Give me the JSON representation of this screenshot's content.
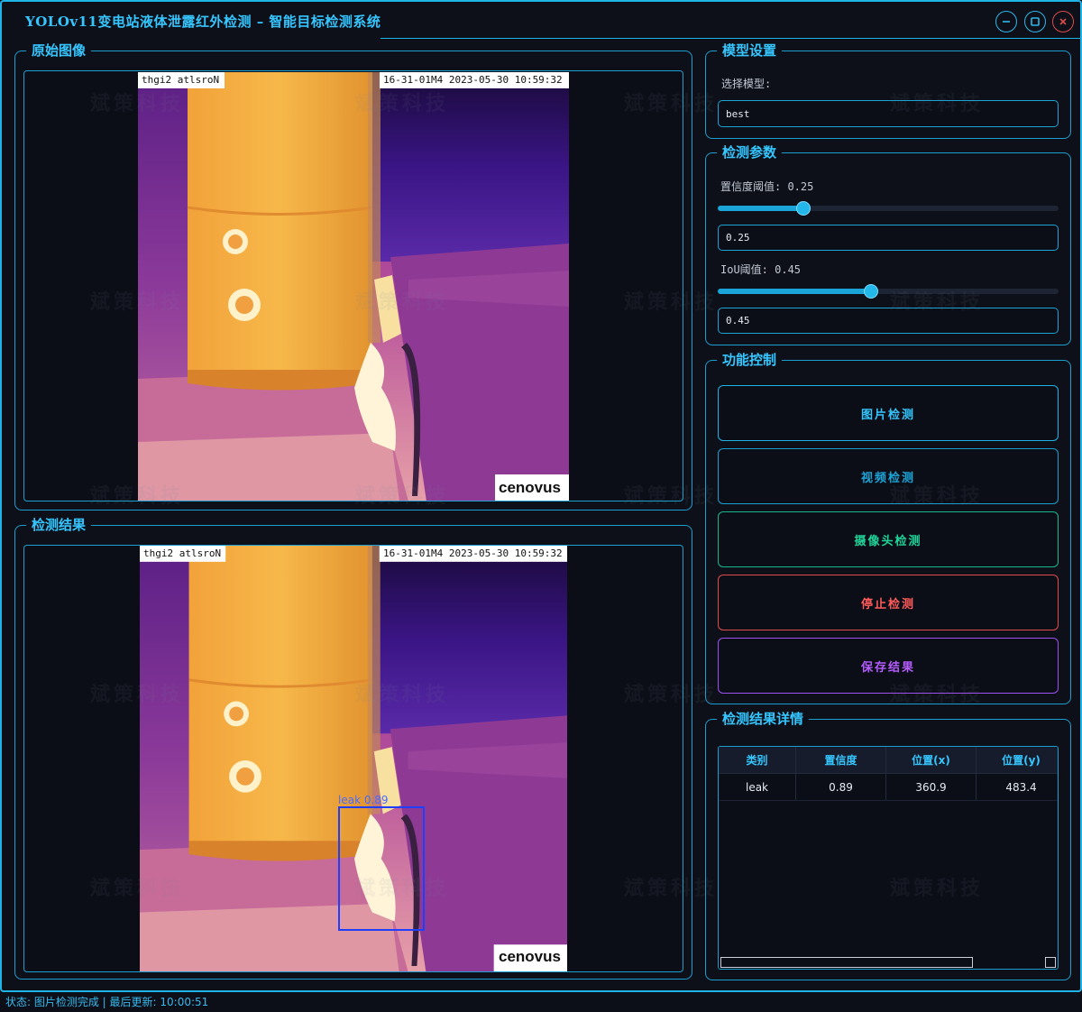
{
  "window": {
    "title": "YOLOv11变电站液体泄露红外检测 – 智能目标检测系统"
  },
  "panels": {
    "original_title": "原始图像",
    "result_title": "检测结果",
    "image_overlay_left": "thgi2 atlsroN",
    "image_overlay_right": "16-31-01M4 2023-05-30 10:59:32",
    "image_logo": "cenovus",
    "detection_box_label": "leak 0.89"
  },
  "model": {
    "title": "模型设置",
    "select_label": "选择模型:",
    "selected": "best"
  },
  "params": {
    "title": "检测参数",
    "conf_label": "置信度阈值: 0.25",
    "conf_value": "0.25",
    "conf_level": 0.25,
    "iou_label": "IoU阈值: 0.45",
    "iou_value": "0.45",
    "iou_level": 0.45
  },
  "controls": {
    "title": "功能控制",
    "image_btn": "图片检测",
    "video_btn": "视频检测",
    "camera_btn": "摄像头检测",
    "stop_btn": "停止检测",
    "save_btn": "保存结果"
  },
  "results": {
    "title": "检测结果详情",
    "headers": [
      "类别",
      "置信度",
      "位置(x)",
      "位置(y)"
    ],
    "rows": [
      [
        "leak",
        "0.89",
        "360.9",
        "483.4"
      ]
    ]
  },
  "status": {
    "text": "状态: 图片检测完成 | 最后更新: 10:00:51"
  },
  "watermark": "斌策科技",
  "colors": {
    "accent": "#35c6ff",
    "video_btn": "#1aa4d8",
    "camera_btn": "#1fd49a",
    "stop_btn": "#ff5b5b",
    "save_btn": "#b45cff",
    "detection_box": "#1f3fff"
  }
}
